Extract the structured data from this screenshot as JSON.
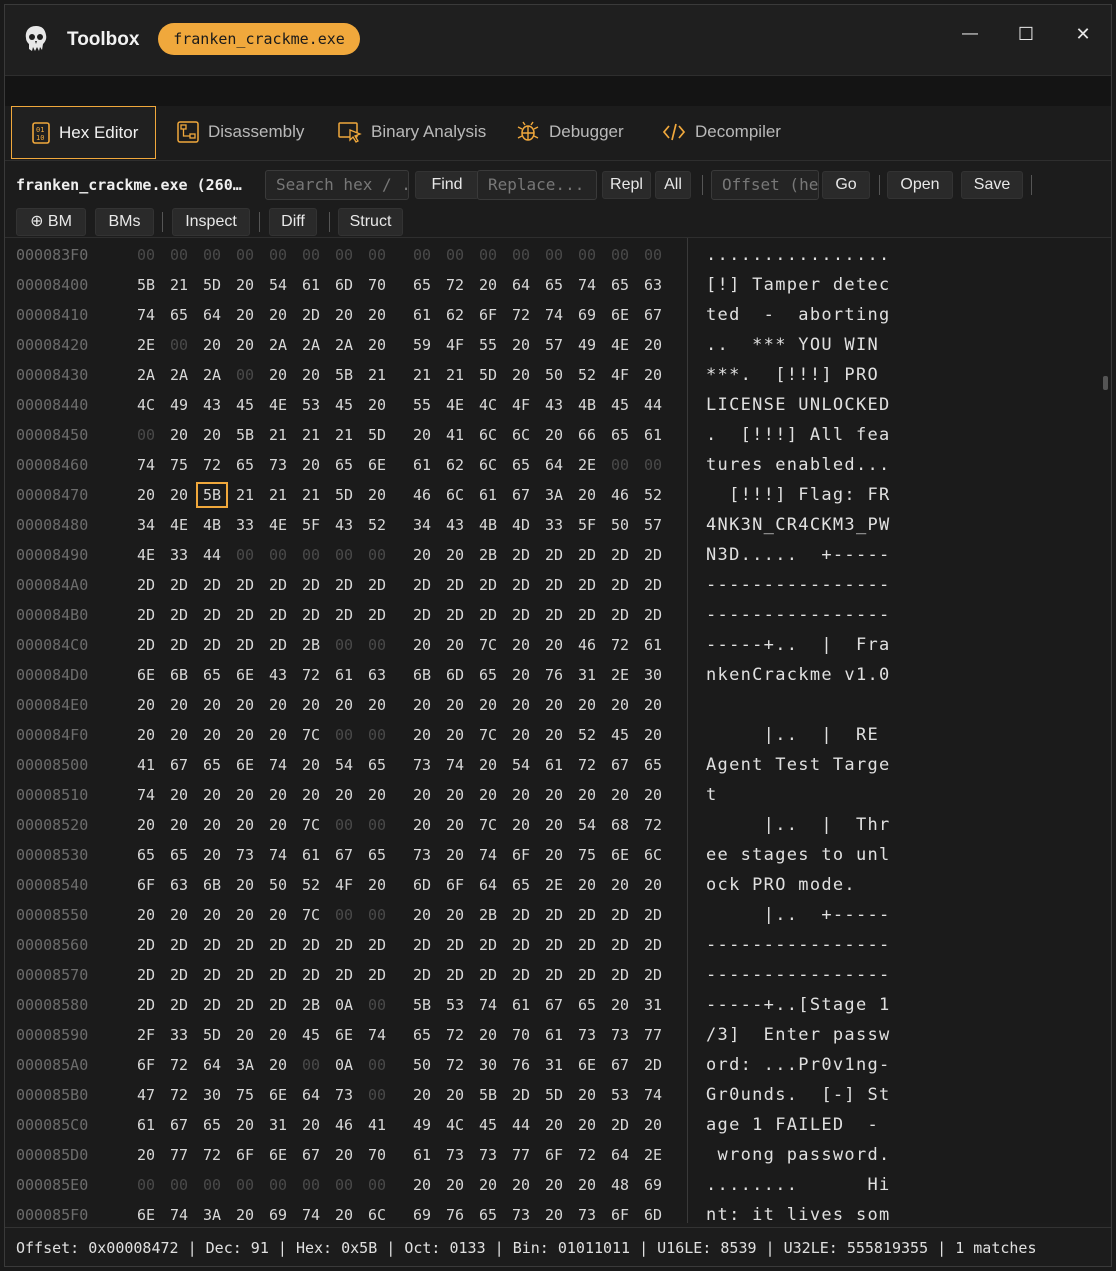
{
  "app": {
    "title": "Toolbox",
    "file_pill": "franken_crackme.exe"
  },
  "window_controls": {
    "minimize": "—",
    "maximize": "☐",
    "close": "✕"
  },
  "tabs": [
    {
      "label": "Hex Editor",
      "icon": "binary-file-icon",
      "active": true
    },
    {
      "label": "Disassembly",
      "icon": "flowchart-icon",
      "active": false
    },
    {
      "label": "Binary Analysis",
      "icon": "cursor-window-icon",
      "active": false
    },
    {
      "label": "Debugger",
      "icon": "bug-icon",
      "active": false
    },
    {
      "label": "Decompiler",
      "icon": "code-icon",
      "active": false
    }
  ],
  "toolbar": {
    "file_name": "franken_crackme.exe (260…",
    "search_placeholder": "Search hex / ...",
    "find": "Find",
    "replace_placeholder": "Replace...",
    "repl": "Repl",
    "all": "All",
    "offset_placeholder": "Offset (hex)",
    "go": "Go",
    "open": "Open",
    "save": "Save",
    "bm": "⊕ BM",
    "bms": "BMs",
    "inspect": "Inspect",
    "diff": "Diff",
    "struct": "Struct"
  },
  "colors": {
    "accent": "#f0a83c",
    "background": "#1b1b1b",
    "zero_byte": "#4a4a4a"
  },
  "hex_rows": [
    {
      "offset": "000083F0",
      "bytes": [
        "00",
        "00",
        "00",
        "00",
        "00",
        "00",
        "00",
        "00",
        "00",
        "00",
        "00",
        "00",
        "00",
        "00",
        "00",
        "00"
      ],
      "ascii": "................"
    },
    {
      "offset": "00008400",
      "bytes": [
        "5B",
        "21",
        "5D",
        "20",
        "54",
        "61",
        "6D",
        "70",
        "65",
        "72",
        "20",
        "64",
        "65",
        "74",
        "65",
        "63"
      ],
      "ascii": "[!] Tamper detec"
    },
    {
      "offset": "00008410",
      "bytes": [
        "74",
        "65",
        "64",
        "20",
        "20",
        "2D",
        "20",
        "20",
        "61",
        "62",
        "6F",
        "72",
        "74",
        "69",
        "6E",
        "67"
      ],
      "ascii": "ted  -  aborting"
    },
    {
      "offset": "00008420",
      "bytes": [
        "2E",
        "00",
        "20",
        "20",
        "2A",
        "2A",
        "2A",
        "20",
        "59",
        "4F",
        "55",
        "20",
        "57",
        "49",
        "4E",
        "20"
      ],
      "ascii": "..  *** YOU WIN "
    },
    {
      "offset": "00008430",
      "bytes": [
        "2A",
        "2A",
        "2A",
        "00",
        "20",
        "20",
        "5B",
        "21",
        "21",
        "21",
        "5D",
        "20",
        "50",
        "52",
        "4F",
        "20"
      ],
      "ascii": "***.  [!!!] PRO "
    },
    {
      "offset": "00008440",
      "bytes": [
        "4C",
        "49",
        "43",
        "45",
        "4E",
        "53",
        "45",
        "20",
        "55",
        "4E",
        "4C",
        "4F",
        "43",
        "4B",
        "45",
        "44"
      ],
      "ascii": "LICENSE UNLOCKED"
    },
    {
      "offset": "00008450",
      "bytes": [
        "00",
        "20",
        "20",
        "5B",
        "21",
        "21",
        "21",
        "5D",
        "20",
        "41",
        "6C",
        "6C",
        "20",
        "66",
        "65",
        "61"
      ],
      "ascii": ".  [!!!] All fea"
    },
    {
      "offset": "00008460",
      "bytes": [
        "74",
        "75",
        "72",
        "65",
        "73",
        "20",
        "65",
        "6E",
        "61",
        "62",
        "6C",
        "65",
        "64",
        "2E",
        "00",
        "00"
      ],
      "ascii": "tures enabled..."
    },
    {
      "offset": "00008470",
      "bytes": [
        "20",
        "20",
        "5B",
        "21",
        "21",
        "21",
        "5D",
        "20",
        "46",
        "6C",
        "61",
        "67",
        "3A",
        "20",
        "46",
        "52"
      ],
      "ascii": "  [!!!] Flag: FR"
    },
    {
      "offset": "00008480",
      "bytes": [
        "34",
        "4E",
        "4B",
        "33",
        "4E",
        "5F",
        "43",
        "52",
        "34",
        "43",
        "4B",
        "4D",
        "33",
        "5F",
        "50",
        "57"
      ],
      "ascii": "4NK3N_CR4CKM3_PW"
    },
    {
      "offset": "00008490",
      "bytes": [
        "4E",
        "33",
        "44",
        "00",
        "00",
        "00",
        "00",
        "00",
        "20",
        "20",
        "2B",
        "2D",
        "2D",
        "2D",
        "2D",
        "2D"
      ],
      "ascii": "N3D.....  +-----"
    },
    {
      "offset": "000084A0",
      "bytes": [
        "2D",
        "2D",
        "2D",
        "2D",
        "2D",
        "2D",
        "2D",
        "2D",
        "2D",
        "2D",
        "2D",
        "2D",
        "2D",
        "2D",
        "2D",
        "2D"
      ],
      "ascii": "----------------"
    },
    {
      "offset": "000084B0",
      "bytes": [
        "2D",
        "2D",
        "2D",
        "2D",
        "2D",
        "2D",
        "2D",
        "2D",
        "2D",
        "2D",
        "2D",
        "2D",
        "2D",
        "2D",
        "2D",
        "2D"
      ],
      "ascii": "----------------"
    },
    {
      "offset": "000084C0",
      "bytes": [
        "2D",
        "2D",
        "2D",
        "2D",
        "2D",
        "2B",
        "00",
        "00",
        "20",
        "20",
        "7C",
        "20",
        "20",
        "46",
        "72",
        "61"
      ],
      "ascii": "-----+..  |  Fra"
    },
    {
      "offset": "000084D0",
      "bytes": [
        "6E",
        "6B",
        "65",
        "6E",
        "43",
        "72",
        "61",
        "63",
        "6B",
        "6D",
        "65",
        "20",
        "76",
        "31",
        "2E",
        "30"
      ],
      "ascii": "nkenCrackme v1.0"
    },
    {
      "offset": "000084E0",
      "bytes": [
        "20",
        "20",
        "20",
        "20",
        "20",
        "20",
        "20",
        "20",
        "20",
        "20",
        "20",
        "20",
        "20",
        "20",
        "20",
        "20"
      ],
      "ascii": "                "
    },
    {
      "offset": "000084F0",
      "bytes": [
        "20",
        "20",
        "20",
        "20",
        "20",
        "7C",
        "00",
        "00",
        "20",
        "20",
        "7C",
        "20",
        "20",
        "52",
        "45",
        "20"
      ],
      "ascii": "     |..  |  RE "
    },
    {
      "offset": "00008500",
      "bytes": [
        "41",
        "67",
        "65",
        "6E",
        "74",
        "20",
        "54",
        "65",
        "73",
        "74",
        "20",
        "54",
        "61",
        "72",
        "67",
        "65"
      ],
      "ascii": "Agent Test Targe"
    },
    {
      "offset": "00008510",
      "bytes": [
        "74",
        "20",
        "20",
        "20",
        "20",
        "20",
        "20",
        "20",
        "20",
        "20",
        "20",
        "20",
        "20",
        "20",
        "20",
        "20"
      ],
      "ascii": "t               "
    },
    {
      "offset": "00008520",
      "bytes": [
        "20",
        "20",
        "20",
        "20",
        "20",
        "7C",
        "00",
        "00",
        "20",
        "20",
        "7C",
        "20",
        "20",
        "54",
        "68",
        "72"
      ],
      "ascii": "     |..  |  Thr"
    },
    {
      "offset": "00008530",
      "bytes": [
        "65",
        "65",
        "20",
        "73",
        "74",
        "61",
        "67",
        "65",
        "73",
        "20",
        "74",
        "6F",
        "20",
        "75",
        "6E",
        "6C"
      ],
      "ascii": "ee stages to unl"
    },
    {
      "offset": "00008540",
      "bytes": [
        "6F",
        "63",
        "6B",
        "20",
        "50",
        "52",
        "4F",
        "20",
        "6D",
        "6F",
        "64",
        "65",
        "2E",
        "20",
        "20",
        "20"
      ],
      "ascii": "ock PRO mode.   "
    },
    {
      "offset": "00008550",
      "bytes": [
        "20",
        "20",
        "20",
        "20",
        "20",
        "7C",
        "00",
        "00",
        "20",
        "20",
        "2B",
        "2D",
        "2D",
        "2D",
        "2D",
        "2D"
      ],
      "ascii": "     |..  +-----"
    },
    {
      "offset": "00008560",
      "bytes": [
        "2D",
        "2D",
        "2D",
        "2D",
        "2D",
        "2D",
        "2D",
        "2D",
        "2D",
        "2D",
        "2D",
        "2D",
        "2D",
        "2D",
        "2D",
        "2D"
      ],
      "ascii": "----------------"
    },
    {
      "offset": "00008570",
      "bytes": [
        "2D",
        "2D",
        "2D",
        "2D",
        "2D",
        "2D",
        "2D",
        "2D",
        "2D",
        "2D",
        "2D",
        "2D",
        "2D",
        "2D",
        "2D",
        "2D"
      ],
      "ascii": "----------------"
    },
    {
      "offset": "00008580",
      "bytes": [
        "2D",
        "2D",
        "2D",
        "2D",
        "2D",
        "2B",
        "0A",
        "00",
        "5B",
        "53",
        "74",
        "61",
        "67",
        "65",
        "20",
        "31"
      ],
      "ascii": "-----+..[Stage 1"
    },
    {
      "offset": "00008590",
      "bytes": [
        "2F",
        "33",
        "5D",
        "20",
        "20",
        "45",
        "6E",
        "74",
        "65",
        "72",
        "20",
        "70",
        "61",
        "73",
        "73",
        "77"
      ],
      "ascii": "/3]  Enter passw"
    },
    {
      "offset": "000085A0",
      "bytes": [
        "6F",
        "72",
        "64",
        "3A",
        "20",
        "00",
        "0A",
        "00",
        "50",
        "72",
        "30",
        "76",
        "31",
        "6E",
        "67",
        "2D"
      ],
      "ascii": "ord: ...Pr0v1ng-"
    },
    {
      "offset": "000085B0",
      "bytes": [
        "47",
        "72",
        "30",
        "75",
        "6E",
        "64",
        "73",
        "00",
        "20",
        "20",
        "5B",
        "2D",
        "5D",
        "20",
        "53",
        "74"
      ],
      "ascii": "Gr0unds.  [-] St"
    },
    {
      "offset": "000085C0",
      "bytes": [
        "61",
        "67",
        "65",
        "20",
        "31",
        "20",
        "46",
        "41",
        "49",
        "4C",
        "45",
        "44",
        "20",
        "20",
        "2D",
        "20"
      ],
      "ascii": "age 1 FAILED  - "
    },
    {
      "offset": "000085D0",
      "bytes": [
        "20",
        "77",
        "72",
        "6F",
        "6E",
        "67",
        "20",
        "70",
        "61",
        "73",
        "73",
        "77",
        "6F",
        "72",
        "64",
        "2E"
      ],
      "ascii": " wrong password."
    },
    {
      "offset": "000085E0",
      "bytes": [
        "00",
        "00",
        "00",
        "00",
        "00",
        "00",
        "00",
        "00",
        "20",
        "20",
        "20",
        "20",
        "20",
        "20",
        "48",
        "69"
      ],
      "ascii": "........      Hi"
    },
    {
      "offset": "000085F0",
      "bytes": [
        "6E",
        "74",
        "3A",
        "20",
        "69",
        "74",
        "20",
        "6C",
        "69",
        "76",
        "65",
        "73",
        "20",
        "73",
        "6F",
        "6D"
      ],
      "ascii": "nt: it lives som"
    }
  ],
  "selected": {
    "row": 8,
    "col": 2
  },
  "status": "Offset: 0x00008472 | Dec: 91 | Hex: 0x5B | Oct: 0133 | Bin: 01011011 | U16LE: 8539 | U32LE: 555819355 | 1 matches"
}
